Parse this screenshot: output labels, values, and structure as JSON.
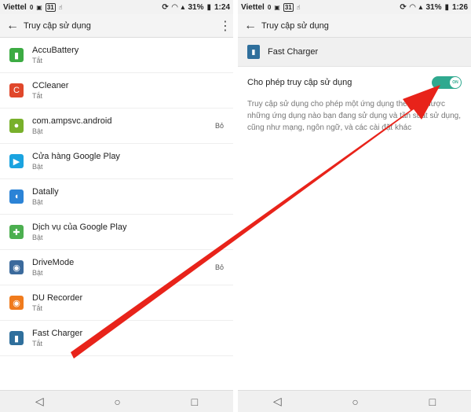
{
  "left": {
    "status": {
      "carrier": "Viettel",
      "data_rate": "0",
      "calendar": "31",
      "battery": "31%",
      "time": "1:24"
    },
    "title": "Truy cập sử dụng",
    "apps": [
      {
        "name": "AccuBattery",
        "state": "Tắt",
        "right": "",
        "color": "#3cab43",
        "icon_symbol": "▮"
      },
      {
        "name": "CCleaner",
        "state": "Tắt",
        "right": "",
        "color": "#e0472b",
        "icon_symbol": "C"
      },
      {
        "name": "com.ampsvc.android",
        "state": "Bật",
        "right": "Bỏ",
        "color": "#78b02b",
        "icon_symbol": "●"
      },
      {
        "name": "Cửa hàng Google Play",
        "state": "Bật",
        "right": "",
        "color": "#1aa3e0",
        "icon_symbol": "▶"
      },
      {
        "name": "Datally",
        "state": "Bật",
        "right": "",
        "color": "#2b83d6",
        "icon_symbol": "◖"
      },
      {
        "name": "Dịch vụ của Google Play",
        "state": "Bật",
        "right": "",
        "color": "#4caf50",
        "icon_symbol": "✚"
      },
      {
        "name": "DriveMode",
        "state": "Bật",
        "right": "Bỏ",
        "color": "#3b6a9c",
        "icon_symbol": "◉"
      },
      {
        "name": "DU Recorder",
        "state": "Tắt",
        "right": "",
        "color": "#f07b1d",
        "icon_symbol": "◉"
      },
      {
        "name": "Fast Charger",
        "state": "Tắt",
        "right": "",
        "color": "#2f6f9c",
        "icon_symbol": "▮"
      }
    ]
  },
  "right": {
    "status": {
      "carrier": "Viettel",
      "data_rate": "0",
      "calendar": "31",
      "battery": "31%",
      "time": "1:26"
    },
    "title": "Truy cập sử dụng",
    "app_name": "Fast Charger",
    "permission_label": "Cho phép truy cập sử dụng",
    "toggle_text": "ON",
    "description": "Truy cập sử dụng cho phép một ứng dụng theo dõi được những ứng dụng nào bạn đang sử dụng và tần suất sử dụng, cũng như mạng, ngôn ngữ, và các cài đặt khác"
  },
  "nav": {
    "back": "◁",
    "home": "○",
    "recents": "□"
  },
  "colors": {
    "arrow": "#e8231a",
    "toggle_on": "#2fa98f"
  }
}
